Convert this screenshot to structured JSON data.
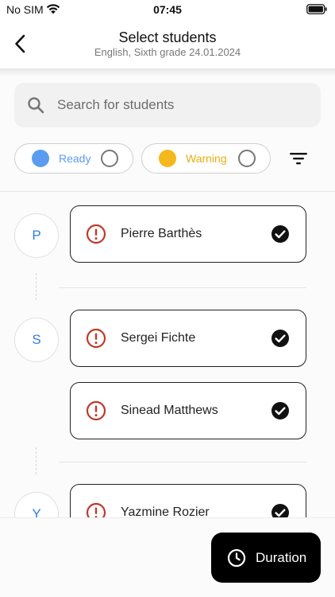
{
  "status_bar": {
    "carrier": "No SIM",
    "time": "07:45"
  },
  "header": {
    "title": "Select students",
    "subtitle": "English, Sixth grade 24.01.2024",
    "back_icon": "chevron-left-icon"
  },
  "search": {
    "placeholder": "Search for students",
    "value": "",
    "icon": "search-icon"
  },
  "filters": {
    "ready": {
      "label": "Ready",
      "color": "#5b9cf1",
      "enabled": false
    },
    "warning": {
      "label": "Warning",
      "color": "#f4b81c",
      "enabled": false
    },
    "sort_icon": "filter-lines-icon"
  },
  "groups": [
    {
      "letter": "P",
      "students": [
        {
          "name": "Pierre Barthès",
          "status": "warning",
          "selected": true
        }
      ]
    },
    {
      "letter": "S",
      "students": [
        {
          "name": "Sergei Fichte",
          "status": "warning",
          "selected": true
        },
        {
          "name": "Sinead Matthews",
          "status": "warning",
          "selected": true
        }
      ]
    },
    {
      "letter": "Y",
      "students": [
        {
          "name": "Yazmine Rozier",
          "status": "warning",
          "selected": true
        }
      ]
    }
  ],
  "colors": {
    "accent_blue": "#2f7ed8",
    "warning_red": "#c0392b",
    "ready_blue": "#5b9cf1",
    "warning_yellow": "#f4b81c"
  },
  "action_button": {
    "label": "Duration",
    "icon": "clock-icon"
  }
}
